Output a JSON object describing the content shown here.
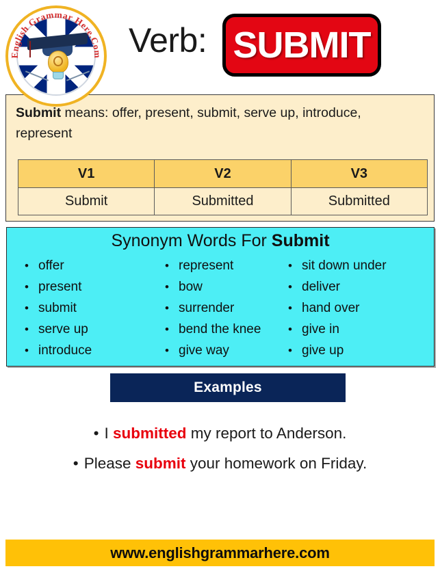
{
  "header": {
    "logo": {
      "name": "english-grammar-here-logo",
      "ring_text": "English Grammar Here.Com",
      "flag": "union-jack",
      "emblem": "graduation-cap-and-lightbulb",
      "ring_color": "#f0b323",
      "ring_text_color": "#d42f2f"
    },
    "verb_label": "Verb:",
    "word": "SUBMIT",
    "word_chip_bg": "#e30613",
    "word_chip_border": "#000000",
    "word_color": "#ffffff"
  },
  "definition": {
    "lead": "Submit",
    "body": " means: offer, present, submit, serve up, introduce, represent",
    "panel_bg": "#fdeecb",
    "table": {
      "headers": [
        "V1",
        "V2",
        "V3"
      ],
      "header_bg": "#fbd269",
      "rows": [
        [
          "Submit",
          "Submitted",
          "Submitted"
        ]
      ]
    }
  },
  "synonyms": {
    "title_prefix": "Synonym Words For ",
    "title_accent": "Submit",
    "panel_bg": "#4deef5",
    "columns": [
      [
        "offer",
        "present",
        "submit",
        "serve up",
        "introduce"
      ],
      [
        "represent",
        "bow",
        "surrender",
        "bend the knee",
        "give way"
      ],
      [
        "sit down under",
        "deliver",
        "hand over",
        "give in",
        "give up"
      ]
    ]
  },
  "examples": {
    "banner_label": "Examples",
    "banner_bg": "#0a2558",
    "highlight_color": "#e8000d",
    "items": [
      {
        "pre": "I ",
        "highlight": "submitted",
        "post": " my report to Anderson."
      },
      {
        "pre": "Please ",
        "highlight": "submit",
        "post": " your homework on Friday."
      }
    ]
  },
  "footer": {
    "url": "www.englishgrammarhere.com",
    "bar_bg": "#ffc107"
  }
}
